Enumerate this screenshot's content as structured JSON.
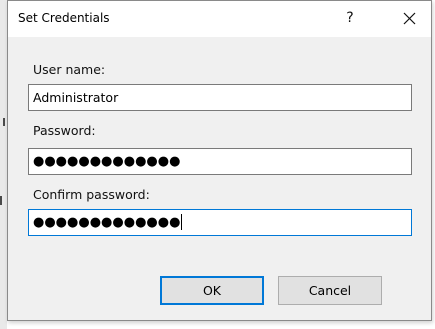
{
  "dialog": {
    "title": "Set Credentials",
    "help_glyph": "?",
    "close_glyph": "✕"
  },
  "fields": {
    "username_label": "User name:",
    "username_value": "Administrator",
    "password_label": "Password:",
    "password_value": "●●●●●●●●●●●●●",
    "confirm_label": "Confirm password:",
    "confirm_value": "●●●●●●●●●●●●●"
  },
  "buttons": {
    "ok_label": "OK",
    "cancel_label": "Cancel"
  },
  "colors": {
    "accent": "#0078d7",
    "dialog_bg": "#f0f0f0"
  }
}
